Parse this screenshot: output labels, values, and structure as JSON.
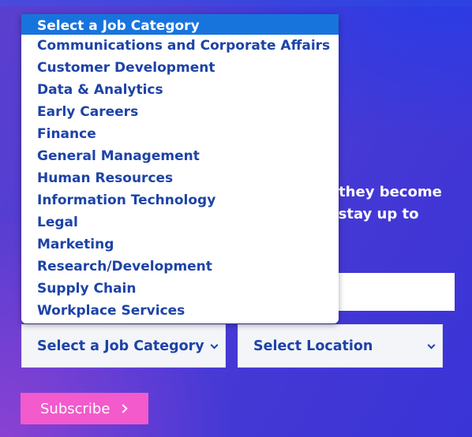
{
  "intro": {
    "text": "n they become\no stay up to\ns."
  },
  "email": {
    "placeholder": ""
  },
  "selects": {
    "category_label": "Select a Job Category",
    "location_label": "Select Location"
  },
  "subscribe_label": "Subscribe",
  "dropdown": {
    "options": [
      "Select a Job Category",
      "Communications and Corporate Affairs",
      "Customer Development",
      "Data & Analytics",
      "Early Careers",
      "Finance",
      "General Management",
      "Human Resources",
      "Information Technology",
      "Legal",
      "Marketing",
      "Research/Development",
      "Supply Chain",
      "Workplace Services"
    ],
    "selected_index": 0
  },
  "colors": {
    "accent_blue": "#1d43a8",
    "highlight": "#1874dd",
    "subscribe_pink": "#f35acb"
  }
}
